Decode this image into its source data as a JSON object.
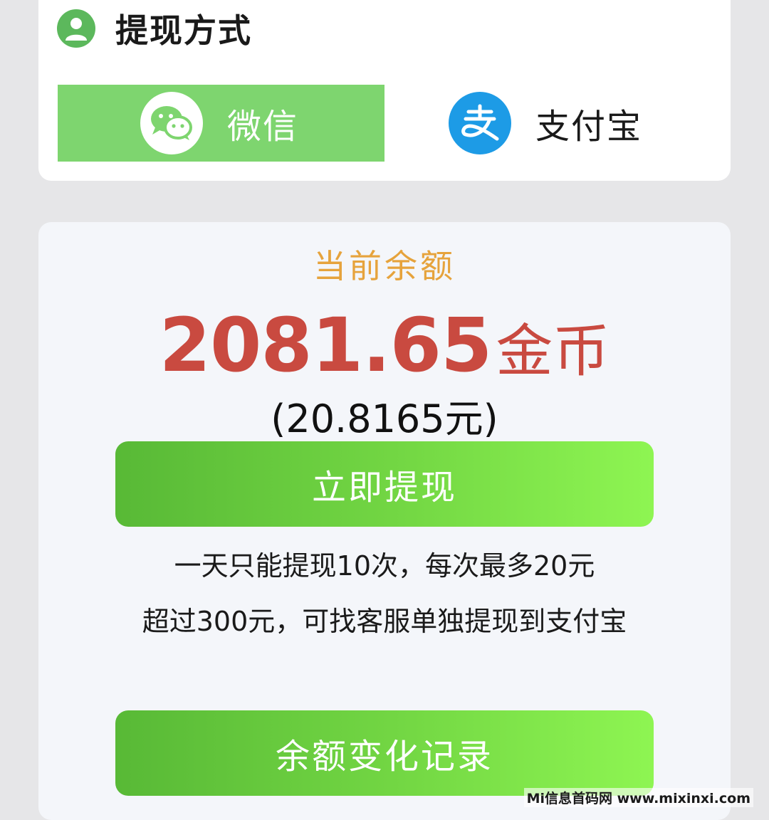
{
  "withdraw_method": {
    "title": "提现方式",
    "icon": "user-icon",
    "options": [
      {
        "label": "微信",
        "icon": "wechat-icon",
        "selected": true
      },
      {
        "label": "支付宝",
        "icon": "alipay-icon",
        "selected": false
      }
    ]
  },
  "balance": {
    "label": "当前余额",
    "amount": "2081.65",
    "unit": "金币",
    "yuan_equivalent": "(20.8165元)"
  },
  "withdraw_button_label": "立即提现",
  "notes": [
    "一天只能提现10次，每次最多20元",
    "超过300元，可找客服单独提现到支付宝"
  ],
  "history_button_label": "余额变化记录",
  "watermark": "Mi信息首码网 www.mixinxi.com",
  "colors": {
    "wechat_green": "#7ed56f",
    "alipay_blue": "#1d9be6",
    "balance_label": "#e6a33c",
    "amount_red": "#c94a40"
  }
}
